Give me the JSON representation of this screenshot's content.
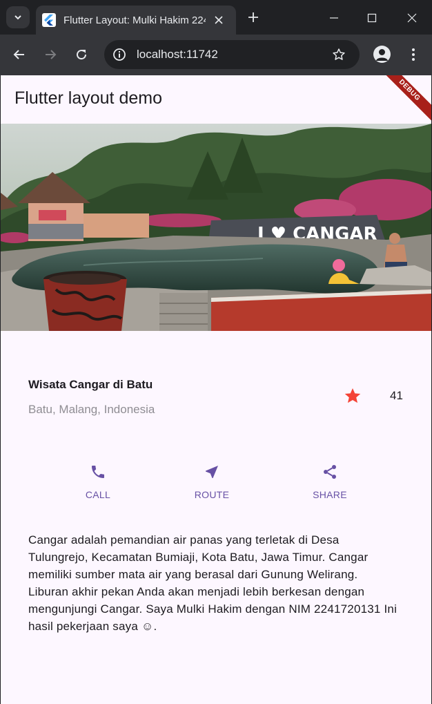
{
  "browser": {
    "tab_title": "Flutter Layout: Mulki Hakim 224",
    "url": "localhost:11742"
  },
  "app": {
    "title": "Flutter layout demo",
    "debug_label": "DEBUG",
    "hero_sign": "I ♥ CANGAR",
    "place": {
      "name": "Wisata Cangar di Batu",
      "location": "Batu, Malang, Indonesia",
      "rating_count": "41"
    },
    "actions": [
      {
        "label": "CALL",
        "icon": "phone-icon"
      },
      {
        "label": "ROUTE",
        "icon": "near-me-icon"
      },
      {
        "label": "SHARE",
        "icon": "share-icon"
      }
    ],
    "description": "Cangar adalah pemandian air panas yang terletak di Desa Tulungrejo, Kecamatan Bumiaji, Kota Batu, Jawa Timur. Cangar memiliki sumber mata air yang berasal dari Gunung Welirang. Liburan akhir pekan Anda akan menjadi lebih berkesan dengan mengunjungi Cangar. Saya Mulki Hakim dengan NIM 2241720131 Ini hasil pekerjaan saya ☺."
  },
  "colors": {
    "accent": "#6750a4",
    "star": "#f44336",
    "background": "#fdf7ff"
  }
}
